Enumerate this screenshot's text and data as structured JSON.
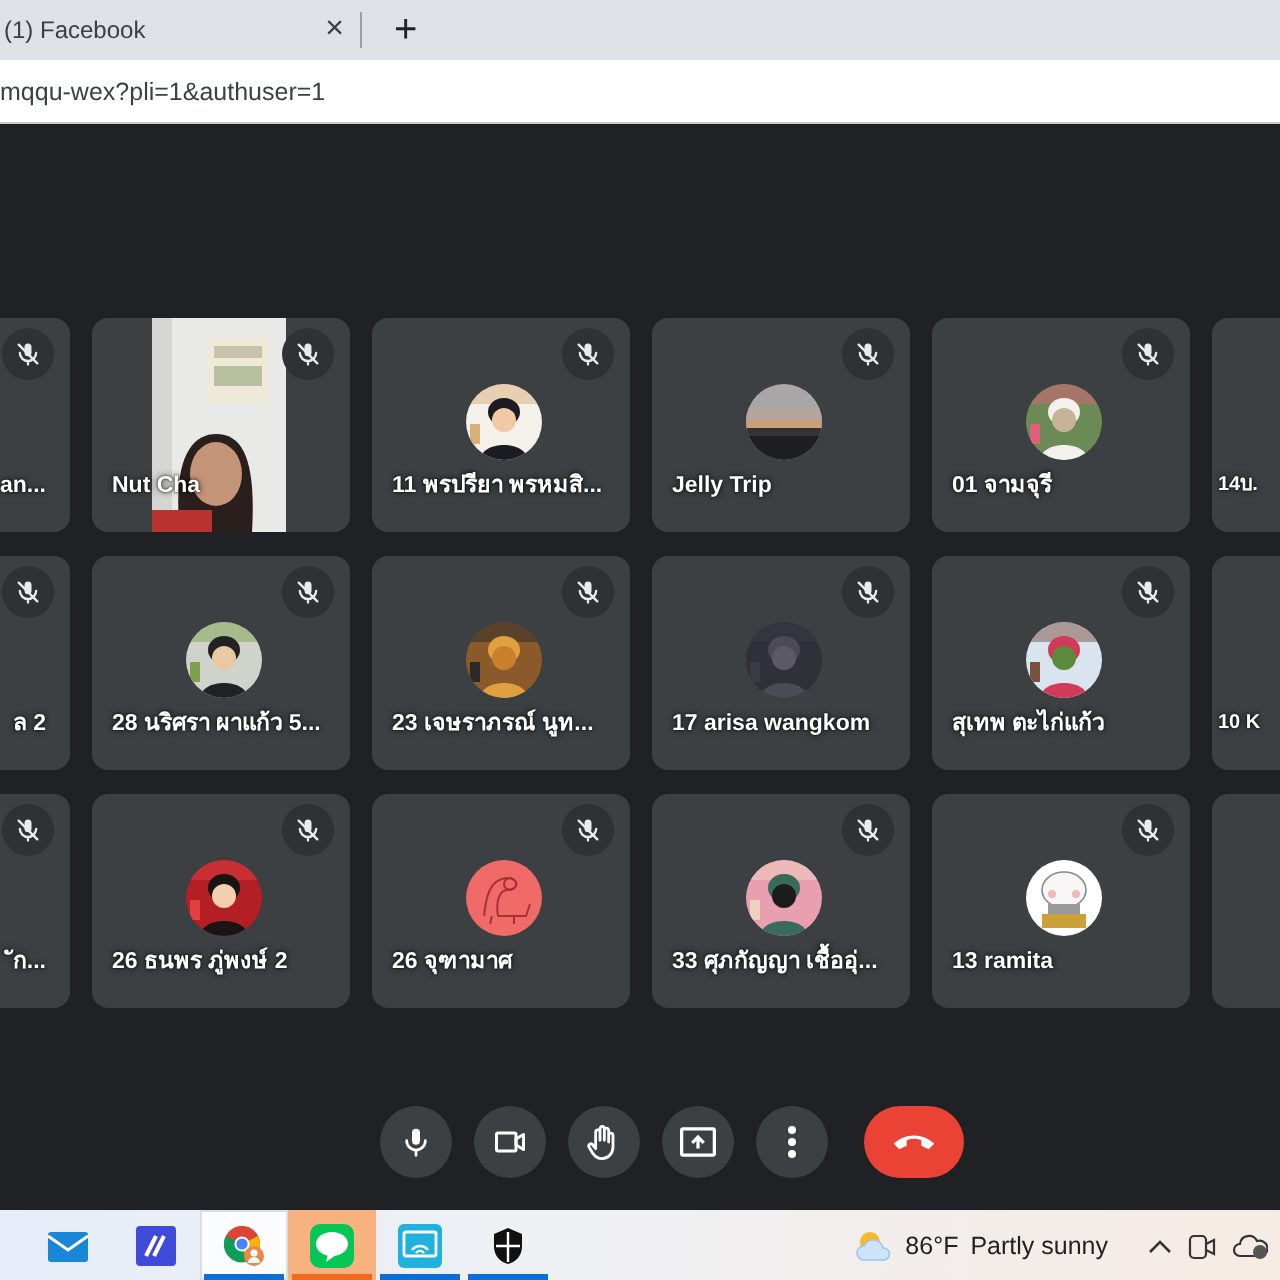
{
  "browser": {
    "tab": {
      "title": "(1) Facebook",
      "close": "×"
    },
    "new_tab": "+",
    "url": "mqqu-wex?pli=1&authuser=1"
  },
  "rows": [
    {
      "tiles": [
        {
          "name": "an...",
          "muted": true,
          "kind": "none"
        },
        {
          "name": "Nut Cha",
          "muted": true,
          "kind": "video"
        },
        {
          "name": "11 พรปรียา พรหมสิ...",
          "muted": true,
          "kind": "avatar"
        },
        {
          "name": "Jelly Trip",
          "muted": true,
          "kind": "avatar"
        },
        {
          "name": "01 จามจุรี",
          "muted": true,
          "kind": "avatar"
        },
        {
          "name": "14บ.",
          "kind": "none"
        }
      ]
    },
    {
      "tiles": [
        {
          "name": "ล 2",
          "muted": true,
          "kind": "none"
        },
        {
          "name": "28 นริศรา ผาแก้ว 5...",
          "muted": true,
          "kind": "avatar"
        },
        {
          "name": "23 เจษราภรณ์ นูท...",
          "muted": true,
          "kind": "avatar"
        },
        {
          "name": "17 arisa wangkom",
          "muted": true,
          "kind": "avatar"
        },
        {
          "name": "สุเทพ ตะไก่แก้ว",
          "muted": true,
          "kind": "avatar"
        },
        {
          "name": "10 K",
          "kind": "none"
        }
      ]
    },
    {
      "tiles": [
        {
          "name": "ัก...",
          "muted": true,
          "kind": "none"
        },
        {
          "name": "26 ธนพร ภู่พงษ์ 2",
          "muted": true,
          "kind": "avatar"
        },
        {
          "name": "26 จุฑามาศ",
          "muted": true,
          "kind": "avatar"
        },
        {
          "name": "33 ศุภกัญญา เชื้ออุ่...",
          "muted": true,
          "kind": "avatar"
        },
        {
          "name": "13 ramita",
          "muted": true,
          "kind": "avatar"
        },
        {
          "kind": "none"
        }
      ]
    }
  ],
  "controls": [
    {
      "kind": "mic"
    },
    {
      "kind": "camera"
    },
    {
      "kind": "hand"
    },
    {
      "kind": "present"
    },
    {
      "kind": "more"
    },
    {
      "kind": "leave"
    }
  ],
  "taskbar": {
    "apps": [
      {
        "kind": "mail",
        "running": false,
        "selected": false
      },
      {
        "kind": "editor",
        "running": false,
        "selected": false
      },
      {
        "kind": "browser",
        "running": true,
        "selected": true
      },
      {
        "kind": "chat",
        "running": true,
        "selected": false,
        "flashing": true
      },
      {
        "kind": "cast",
        "running": true,
        "selected": false
      },
      {
        "kind": "shield",
        "running": true,
        "selected": false
      }
    ],
    "weather": {
      "temperature": "86°F",
      "condition": "Partly sunny"
    },
    "tray": [
      {
        "kind": "chevron"
      },
      {
        "kind": "meet"
      },
      {
        "kind": "cloud"
      }
    ]
  }
}
